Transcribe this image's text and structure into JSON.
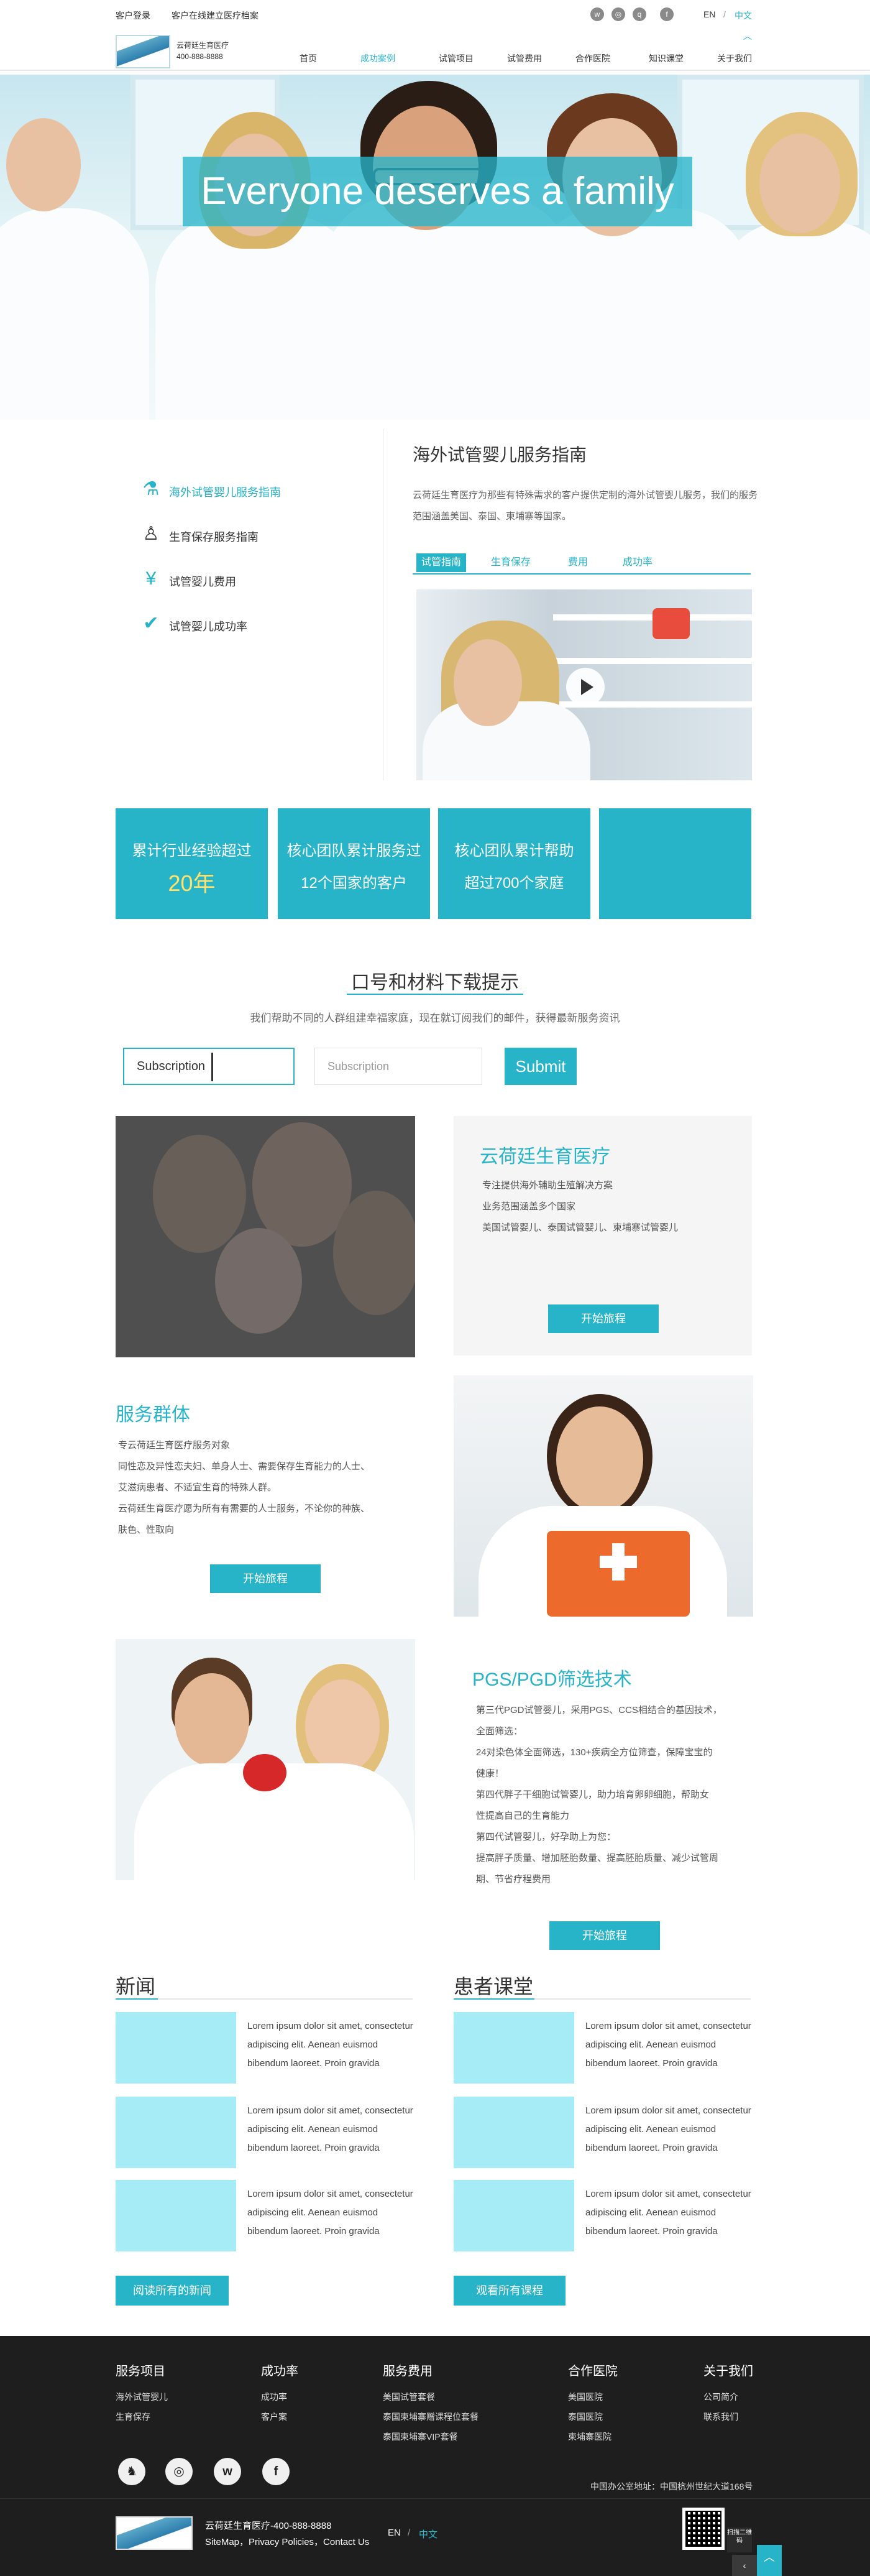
{
  "topbar": {
    "login": "客户登录",
    "consult": "客户在线建立医疗档案",
    "social_icons": [
      "weibo-icon",
      "wechat-icon",
      "qq-icon",
      "facebook-icon"
    ],
    "lang_en": "EN",
    "lang_sep": "/",
    "lang_cn": "中文"
  },
  "header": {
    "logo_name": "云荷廷生育医疗",
    "logo_phone": "400-888-8888",
    "nav": [
      "首页",
      "成功案例",
      "试管项目",
      "试管费用",
      "合作医院",
      "知识课堂",
      "关于我们"
    ],
    "nav_active_index": 1
  },
  "hero": {
    "title": "Everyone deserves a family"
  },
  "guide": {
    "side_items": [
      "海外试管婴儿服务指南",
      "生育保存服务指南",
      "试管婴儿费用",
      "试管婴儿成功率"
    ],
    "title": "海外试管婴儿服务指南",
    "desc": "云荷廷生育医疗为那些有特殊需求的客户提供定制的海外试管婴儿服务，我们的服务范围涵盖美国、泰国、柬埔寨等国家。",
    "tabs": [
      "试管指南",
      "生育保存",
      "费用",
      "成功率"
    ]
  },
  "stats": [
    {
      "line1": "累计行业经验超过",
      "line2": "20年"
    },
    {
      "line1": "核心团队累计服务过",
      "line2": "12个国家的客户"
    },
    {
      "line1": "核心团队累计帮助",
      "line2": "超过700个家庭"
    },
    {
      "line1": "",
      "line2": ""
    }
  ],
  "subscribe": {
    "title": "口号和材料下载提示",
    "desc": "我们帮助不同的人群组建幸福家庭，现在就订阅我们的邮件，获得最新服务资讯",
    "input1_value": "Subscription",
    "input2_placeholder": "Subscription",
    "button": "Submit"
  },
  "block1": {
    "title": "云荷廷生育医疗",
    "lines": [
      "专注提供海外辅助生殖解决方案",
      "业务范围涵盖多个国家",
      "美国试管婴儿、泰国试管婴儿、柬埔寨试管婴儿"
    ],
    "button": "开始旅程"
  },
  "block2": {
    "title": "服务群体",
    "lines": [
      "专云荷廷生育医疗服务对象",
      "同性恋及异性恋夫妇、单身人士、需要保存生育能力的人士、",
      "艾滋病患者、不适宜生育的特殊人群。",
      "云荷廷生育医疗愿为所有有需要的人士服务，不论你的种族、",
      "肤色、性取向"
    ],
    "button": "开始旅程"
  },
  "block3": {
    "title": "PGS/PGD筛选技术",
    "lines": [
      "第三代PGD试管婴儿，采用PGS、CCS相结合的基因技术，",
      "全面筛选：",
      "24对染色体全面筛选，130+疾病全方位筛查，保障宝宝的",
      "健康！",
      "第四代胖子干细胞试管婴儿，助力培育卵卵细胞，帮助女",
      "性提高自己的生育能力",
      "第四代试管婴儿，好孕助上为您：",
      "提高胖子质量、增加胚胎数量、提高胚胎质量、减少试管周",
      "期、节省疗程费用"
    ],
    "button": "开始旅程"
  },
  "news": {
    "title": "新闻",
    "items": [
      {
        "l1": "Lorem ipsum dolor sit amet, consectetur",
        "l2": "adipiscing elit. Aenean euismod",
        "l3": "bibendum laoreet. Proin gravida"
      },
      {
        "l1": "Lorem ipsum dolor sit amet, consectetur",
        "l2": "adipiscing elit. Aenean euismod",
        "l3": "bibendum laoreet. Proin gravida"
      },
      {
        "l1": "Lorem ipsum dolor sit amet, consectetur",
        "l2": "adipiscing elit. Aenean euismod",
        "l3": "bibendum laoreet. Proin gravida"
      }
    ],
    "button": "阅读所有的新闻"
  },
  "classroom": {
    "title": "患者课堂",
    "items": [
      {
        "l1": "Lorem ipsum dolor sit amet, consectetur",
        "l2": "adipiscing elit. Aenean euismod",
        "l3": "bibendum laoreet. Proin gravida"
      },
      {
        "l1": "Lorem ipsum dolor sit amet, consectetur",
        "l2": "adipiscing elit. Aenean euismod",
        "l3": "bibendum laoreet. Proin gravida"
      },
      {
        "l1": "Lorem ipsum dolor sit amet, consectetur",
        "l2": "adipiscing elit. Aenean euismod",
        "l3": "bibendum laoreet. Proin gravida"
      }
    ],
    "button": "观看所有课程"
  },
  "footer": {
    "cols": [
      {
        "head": "服务项目",
        "links": [
          "海外试管婴儿",
          "生育保存"
        ]
      },
      {
        "head": "成功率",
        "links": [
          "成功率",
          "客户案"
        ]
      },
      {
        "head": "服务费用",
        "links": [
          "美国试管套餐",
          "泰国柬埔寨赠课程位套餐",
          "泰国柬埔寨VIP套餐"
        ]
      },
      {
        "head": "合作医院",
        "links": [
          "美国医院",
          "泰国医院",
          "柬埔寨医院"
        ]
      },
      {
        "head": "关于我们",
        "links": [
          "公司简介",
          "联系我们"
        ]
      }
    ],
    "social": [
      "qq-icon",
      "wechat-icon",
      "weibo-icon",
      "facebook-icon"
    ],
    "address": "中国办公室地址：中国杭州世纪大道168号",
    "company_line": "云荷廷生育医疗-400-888-8888",
    "links_line": "SiteMap，Privacy Policies，Contact Us",
    "lang_en": "EN",
    "lang_sep": "/",
    "lang_cn": "中文",
    "qr_caption": "扫描二维码"
  },
  "colors": {
    "accent": "#27b4c9",
    "highlight": "#ffe16b",
    "footer_bg": "#1e1e1e",
    "news_thumb": "#a5ecf6"
  }
}
